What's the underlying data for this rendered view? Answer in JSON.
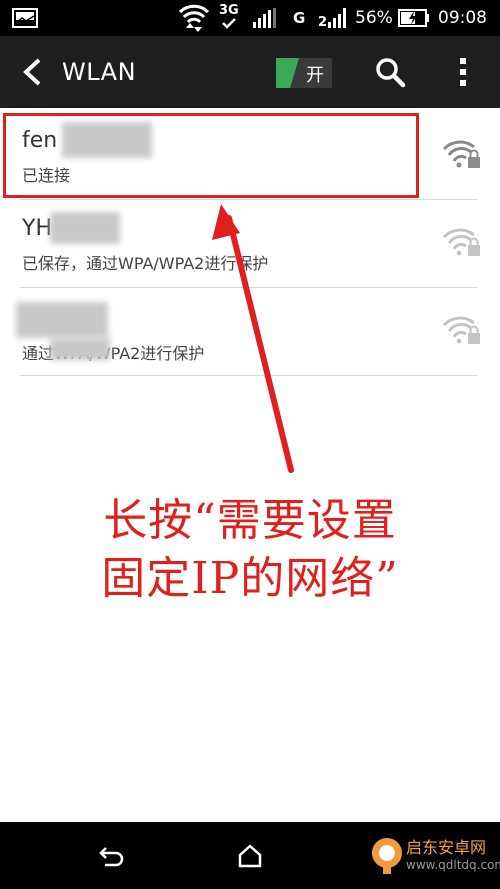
{
  "status_bar": {
    "network_type": "3G",
    "network_g": "G",
    "battery_percent": "56%",
    "time": "09:08",
    "icons": [
      "image-notification-icon",
      "wifi-data-icon",
      "3g-icon",
      "signal-icon",
      "signal-icon",
      "battery-charging-icon"
    ]
  },
  "action_bar": {
    "title": "WLAN",
    "toggle_label": "开",
    "icons": [
      "back-arrow-icon",
      "search-icon",
      "overflow-menu-icon"
    ]
  },
  "networks": [
    {
      "name": "fen",
      "status": "已连接",
      "secured": true,
      "signal": "strong",
      "connected": true
    },
    {
      "name": "YH",
      "status": "已保存，通过WPA/WPA2进行保护",
      "secured": true,
      "signal": "medium",
      "connected": false
    },
    {
      "name": "",
      "status": "通过WPA/WPA2进行保护",
      "secured": true,
      "signal": "medium",
      "connected": false
    }
  ],
  "annotation": {
    "line1": "长按“需要设置",
    "line2": "固定IP的网络”"
  },
  "nav_bar": {
    "icons": [
      "back-icon",
      "home-icon"
    ]
  },
  "watermark": {
    "name": "启东安卓网",
    "url": "www.qdltdq.com"
  },
  "colors": {
    "accent_red": "#e0201c",
    "toggle_green": "#3ea85a",
    "action_bar": "#1e1e1e"
  }
}
